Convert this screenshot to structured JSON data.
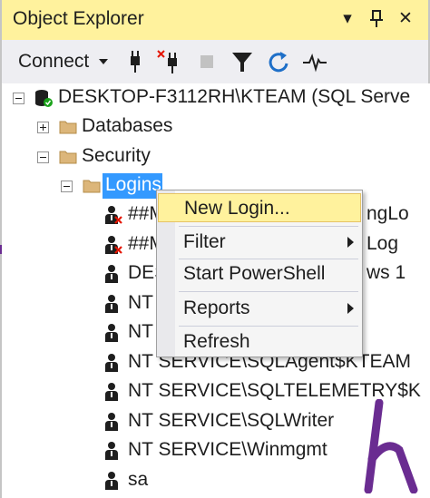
{
  "window": {
    "title": "Object Explorer",
    "dropdown_glyph": "▾",
    "pin_glyph": "⊥",
    "close_glyph": "✕"
  },
  "toolbar": {
    "connect_label": "Connect",
    "icons": [
      "connect-plug-icon",
      "disconnect-plug-icon",
      "stop-icon",
      "filter-icon",
      "refresh-icon",
      "activity-monitor-icon"
    ]
  },
  "tree": {
    "server": "DESKTOP-F3112RH\\KTEAM (SQL Serve",
    "databases": "Databases",
    "security": "Security",
    "logins": "Logins",
    "logins_items": [
      {
        "label": "##M",
        "suffix": "ngLo",
        "icon": "disabled-login-icon"
      },
      {
        "label": "##M",
        "suffix": "Log",
        "icon": "disabled-login-icon"
      },
      {
        "label": "DES",
        "suffix": "ws 1",
        "icon": "login-icon"
      },
      {
        "label": "NT",
        "suffix": "",
        "icon": "login-icon"
      },
      {
        "label": "NT",
        "suffix": "",
        "icon": "login-icon"
      },
      {
        "label": "NT SERVICE\\SQLAgent$KTEAM",
        "suffix": "",
        "icon": "login-icon"
      },
      {
        "label": "NT SERVICE\\SQLTELEMETRY$K",
        "suffix": "",
        "icon": "login-icon"
      },
      {
        "label": "NT SERVICE\\SQLWriter",
        "suffix": "",
        "icon": "login-icon"
      },
      {
        "label": "NT SERVICE\\Winmgmt",
        "suffix": "",
        "icon": "login-icon"
      },
      {
        "label": "sa",
        "suffix": "",
        "icon": "login-icon"
      }
    ]
  },
  "context_menu": {
    "items": [
      "New Login...",
      "Filter",
      "Start PowerShell",
      "Reports",
      "Refresh"
    ]
  },
  "colors": {
    "title_bar": "#fff29d",
    "selection": "#3399ff",
    "menu_highlight": "#fff29d",
    "logo": "#6a2c91"
  }
}
